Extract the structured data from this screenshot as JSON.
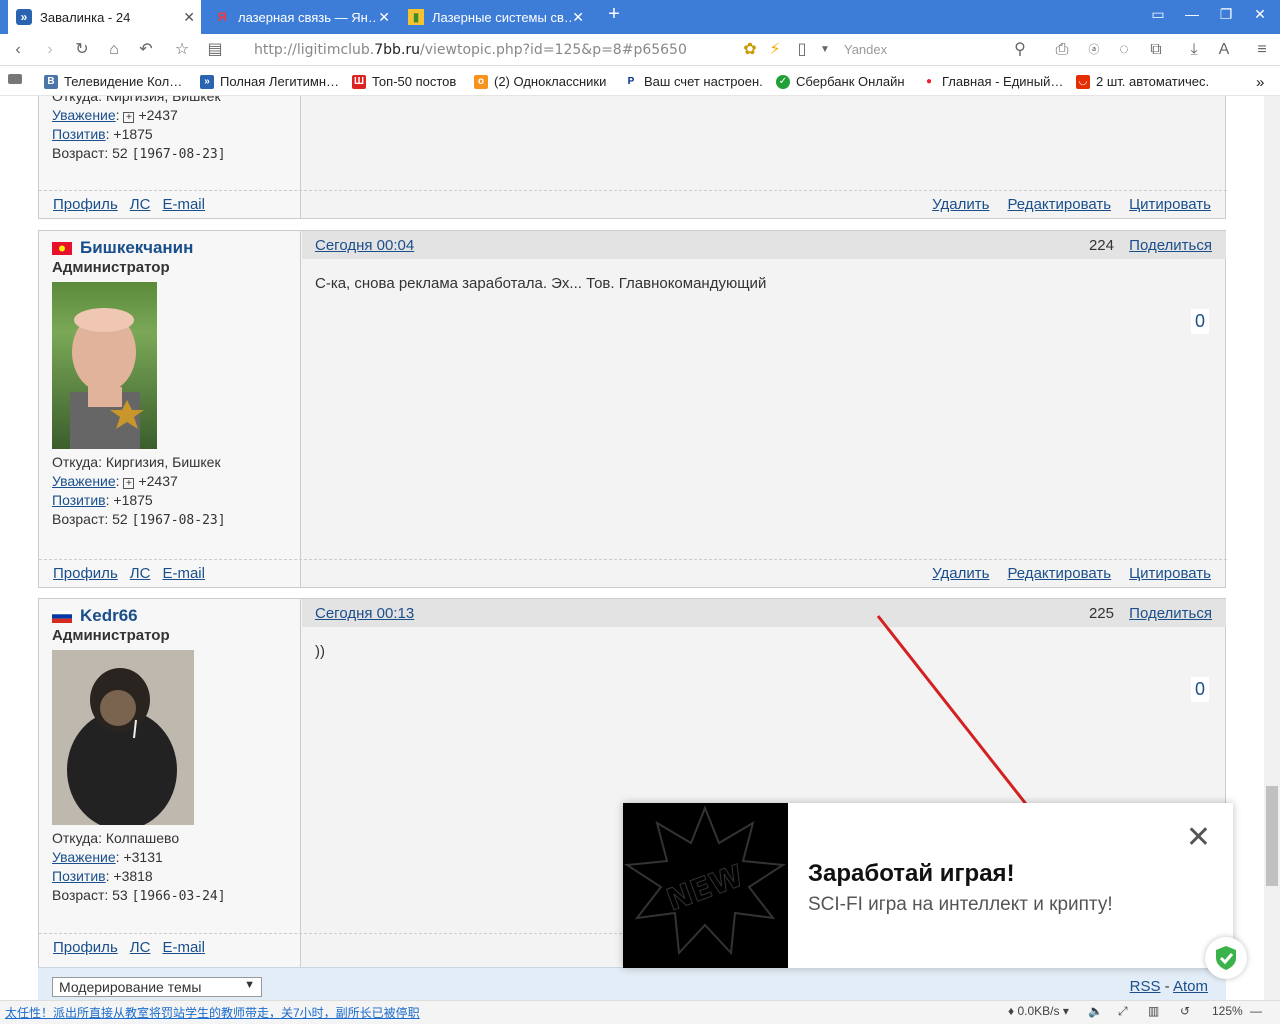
{
  "browser": {
    "tabs": [
      {
        "icon": "forum-icon",
        "label": "Завалинка - 24",
        "active": true
      },
      {
        "icon": "yandex-icon",
        "label": "лазерная связь — Ян…",
        "active": false
      },
      {
        "icon": "chart-icon",
        "label": "Лазерные системы св…",
        "active": false
      }
    ],
    "url_prefix": "http://ligitimclub.",
    "url_domain": "7bb.ru",
    "url_suffix": "/viewtopic.php?id=125&p=8#p65650",
    "search_placeholder": "Yandex",
    "bookmarks": [
      "Телевидение Кол…",
      "Полная Легитимн…",
      "Топ-50 постов",
      "(2) Одноклассники",
      "Ваш счет настроен.",
      "Сбербанк Онлайн",
      "Главная - Единый…",
      "2 шт. автоматичес."
    ]
  },
  "posts": [
    {
      "from": "Откуда: Киргизия, Бишкек",
      "respect_label": "Уважение",
      "respect_value": "+2437",
      "positive_label": "Позитив",
      "positive_value": "+1875",
      "age": "Возраст: 52",
      "birth": "[1967-08-23]"
    },
    {
      "username": "Бишкекчанин",
      "role": "Администратор",
      "date": "Сегодня 00:04",
      "number": "224",
      "share": "Поделиться",
      "text": "С-ка,  снова реклама заработала. Эх... Тов. Главнокомандующий",
      "score": "0",
      "from": "Откуда: Киргизия, Бишкек",
      "respect_label": "Уважение",
      "respect_value": "+2437",
      "positive_label": "Позитив",
      "positive_value": "+1875",
      "age": "Возраст: 52",
      "birth": "[1967-08-23]"
    },
    {
      "username": "Kedr66",
      "role": "Администратор",
      "date": "Сегодня 00:13",
      "number": "225",
      "share": "Поделиться",
      "text": "))",
      "score": "0",
      "from": "Откуда: Колпашево",
      "respect_label": "Уважение",
      "respect_value": "+3131",
      "positive_label": "Позитив",
      "positive_value": "+3818",
      "age": "Возраст: 53",
      "birth": "[1966-03-24]"
    }
  ],
  "post_links": {
    "profile": "Профиль",
    "pm": "ЛС",
    "email": "E-mail",
    "delete": "Удалить",
    "edit": "Редактировать",
    "quote": "Цитировать"
  },
  "popup": {
    "title": "Заработай играя!",
    "subtitle": "SCI-FI игра на интеллект и крипту!",
    "image_text": "NEW"
  },
  "bottom": {
    "moderation": "Модерирование темы",
    "rss": "RSS",
    "sep": "-",
    "atom": "Atom"
  },
  "statusbar": {
    "news": "太任性！派出所直接从教室将罚站学生的教师带走，关7小时，副所长已被停职",
    "speed": "0.0KB/s",
    "zoom": "125%"
  },
  "colors": {
    "tabbar": "#3d7dd8",
    "link": "#1a4f8b",
    "arrow": "#d42020"
  }
}
